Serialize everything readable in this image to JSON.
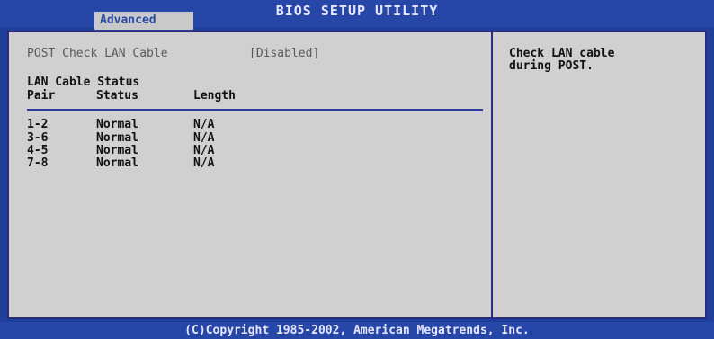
{
  "header": {
    "title": "BIOS SETUP UTILITY",
    "active_tab": "Advanced"
  },
  "settings": {
    "post_check_label": "POST Check LAN Cable",
    "post_check_value": "[Disabled]"
  },
  "status_table": {
    "section_title": "LAN Cable Status",
    "columns": [
      "Pair",
      "Status",
      "Length"
    ],
    "rows": [
      {
        "pair": "1-2",
        "status": "Normal",
        "length": "N/A"
      },
      {
        "pair": "3-6",
        "status": "Normal",
        "length": "N/A"
      },
      {
        "pair": "4-5",
        "status": "Normal",
        "length": "N/A"
      },
      {
        "pair": "7-8",
        "status": "Normal",
        "length": "N/A"
      }
    ]
  },
  "help": {
    "line1": "Check LAN cable",
    "line2": "during POST."
  },
  "footer": {
    "copyright": "(C)Copyright 1985-2002, American Megatrends, Inc."
  },
  "colors": {
    "background": "#1f3f9a",
    "panel": "#d0d0d0",
    "border": "#2a2a80"
  }
}
